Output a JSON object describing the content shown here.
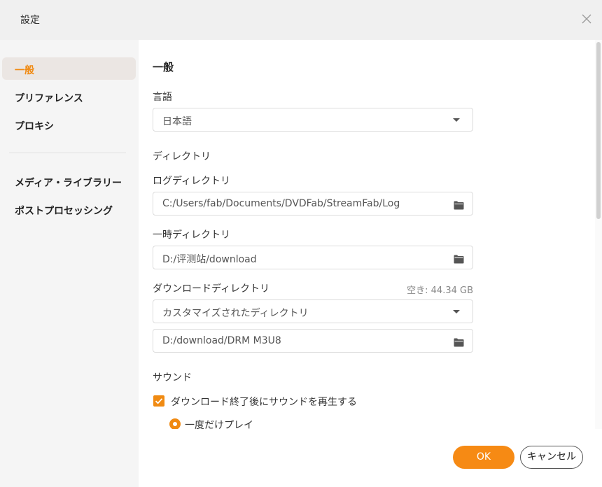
{
  "window": {
    "title": "設定"
  },
  "sidebar": {
    "items": [
      {
        "label": "一般",
        "active": true
      },
      {
        "label": "プリファレンス"
      },
      {
        "label": "プロキシ"
      },
      {
        "label": "メディア・ライブラリー"
      },
      {
        "label": "ポストプロセッシング"
      }
    ]
  },
  "general": {
    "section_title": "一般",
    "language": {
      "label": "言語",
      "value": "日本語"
    },
    "directory": {
      "label": "ディレクトリ",
      "log": {
        "label": "ログディレクトリ",
        "value": "C:/Users/fab/Documents/DVDFab/StreamFab/Log"
      },
      "temp": {
        "label": "一時ディレクトリ",
        "value": "D:/评测站/download"
      },
      "download": {
        "label": "ダウンロードディレクトリ",
        "free_space": "空き: 44.34 GB",
        "mode": "カスタマイズされたディレクトリ",
        "value": "D:/download/DRM M3U8"
      }
    },
    "sound": {
      "label": "サウンド",
      "play_on_finish": {
        "label": "ダウンロード終了後にサウンドを再生する",
        "checked": true
      },
      "play_once": {
        "label": "一度だけプレイ",
        "selected": true
      }
    }
  },
  "footer": {
    "ok_label": "OK",
    "cancel_label": "キャンセル"
  },
  "colors": {
    "accent": "#f68a14",
    "sidebar_bg": "#f5f5f5",
    "titlebar_bg": "#f0f0f0"
  },
  "icons": {
    "close": "close-icon",
    "folder": "folder-icon",
    "dropdown": "chevron-down-icon",
    "checkbox": "check-icon",
    "radio": "radio-dot-icon"
  }
}
